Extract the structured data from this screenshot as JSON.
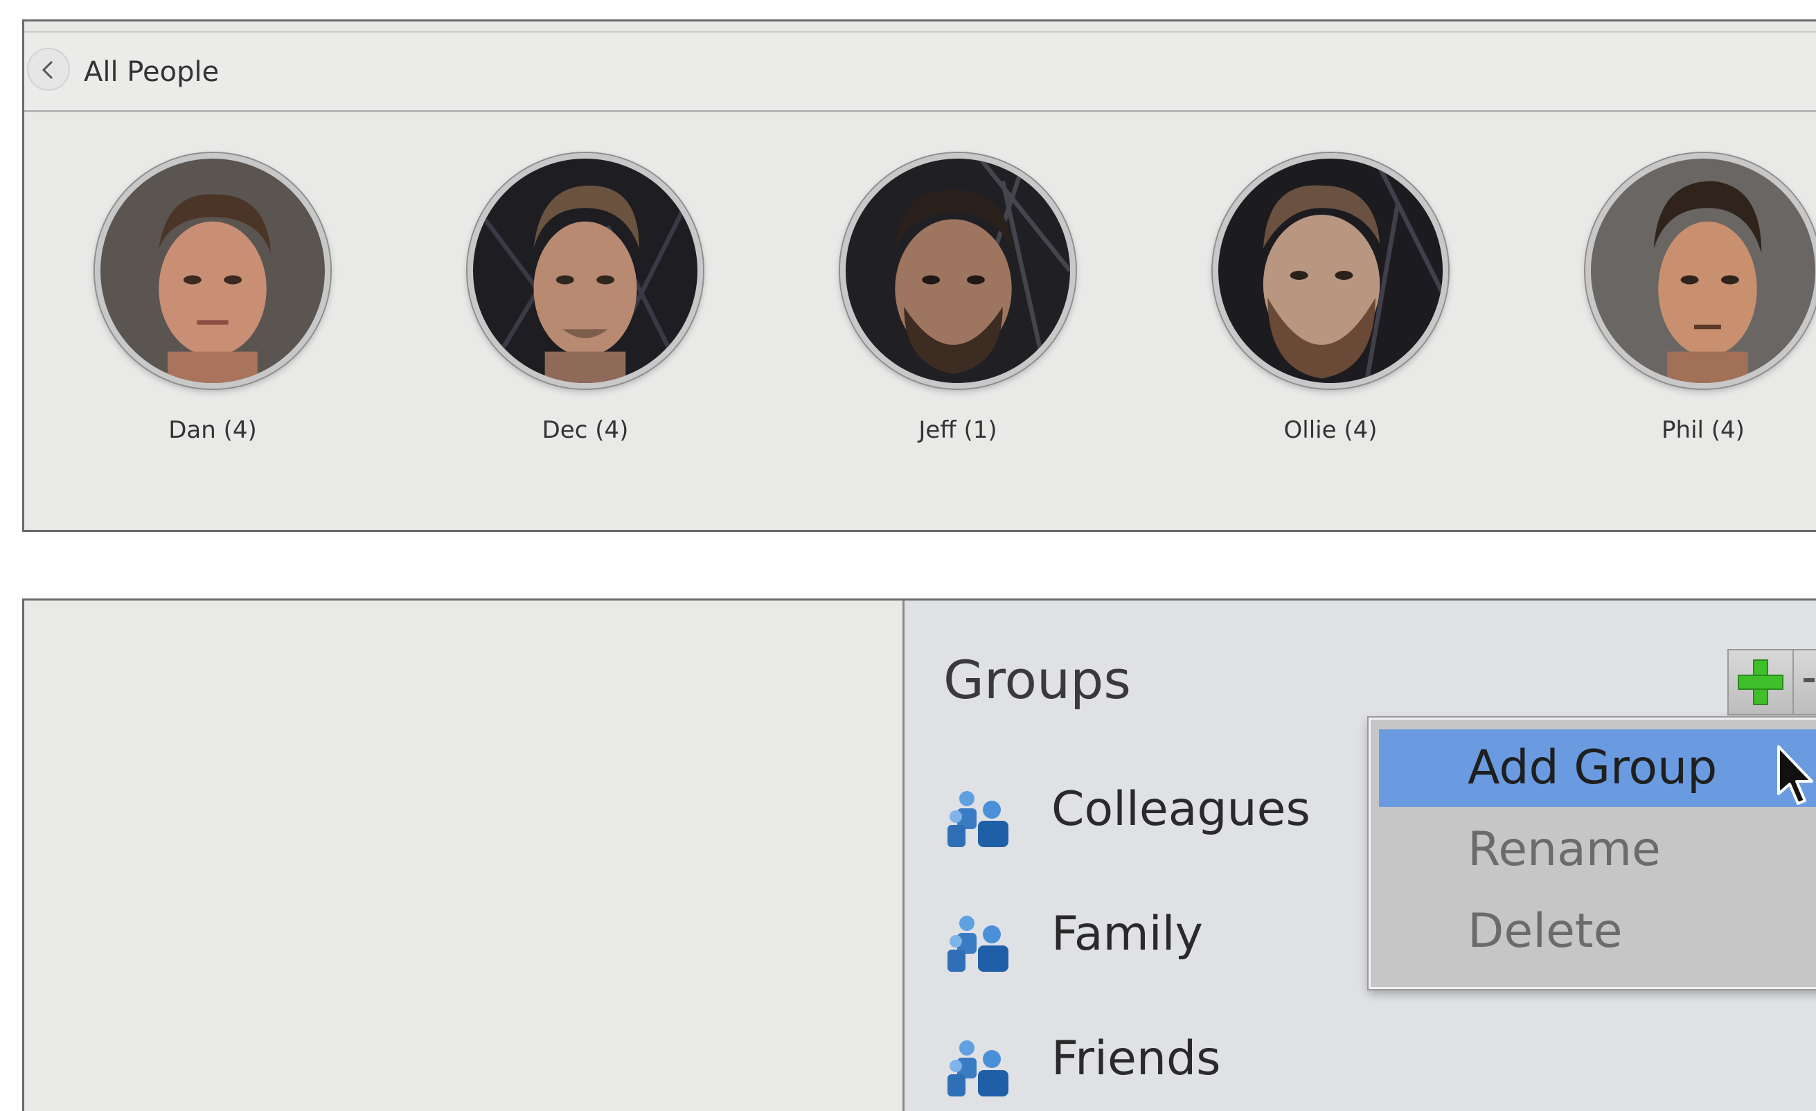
{
  "topbar": {
    "back_icon": "chevron-left-icon",
    "title": "All People"
  },
  "people": [
    {
      "label": "Dan (4)"
    },
    {
      "label": "Dec (4)"
    },
    {
      "label": "Jeff (1)"
    },
    {
      "label": "Ollie (4)"
    },
    {
      "label": "Phil (4)"
    }
  ],
  "groups": {
    "title": "Groups",
    "add_icon": "green-plus-icon",
    "items": [
      {
        "label": "Colleagues",
        "icon": "group-people-icon"
      },
      {
        "label": "Family",
        "icon": "group-people-icon"
      },
      {
        "label": "Friends",
        "icon": "group-people-icon"
      }
    ]
  },
  "menu": {
    "items": [
      {
        "label": "Add Group",
        "active": true
      },
      {
        "label": "Rename",
        "active": false
      },
      {
        "label": "Delete",
        "active": false
      }
    ]
  },
  "colors": {
    "menu_highlight": "#6a9be0",
    "plus_green": "#3fbf2a",
    "group_icon_blue": "#2f6fb5"
  }
}
